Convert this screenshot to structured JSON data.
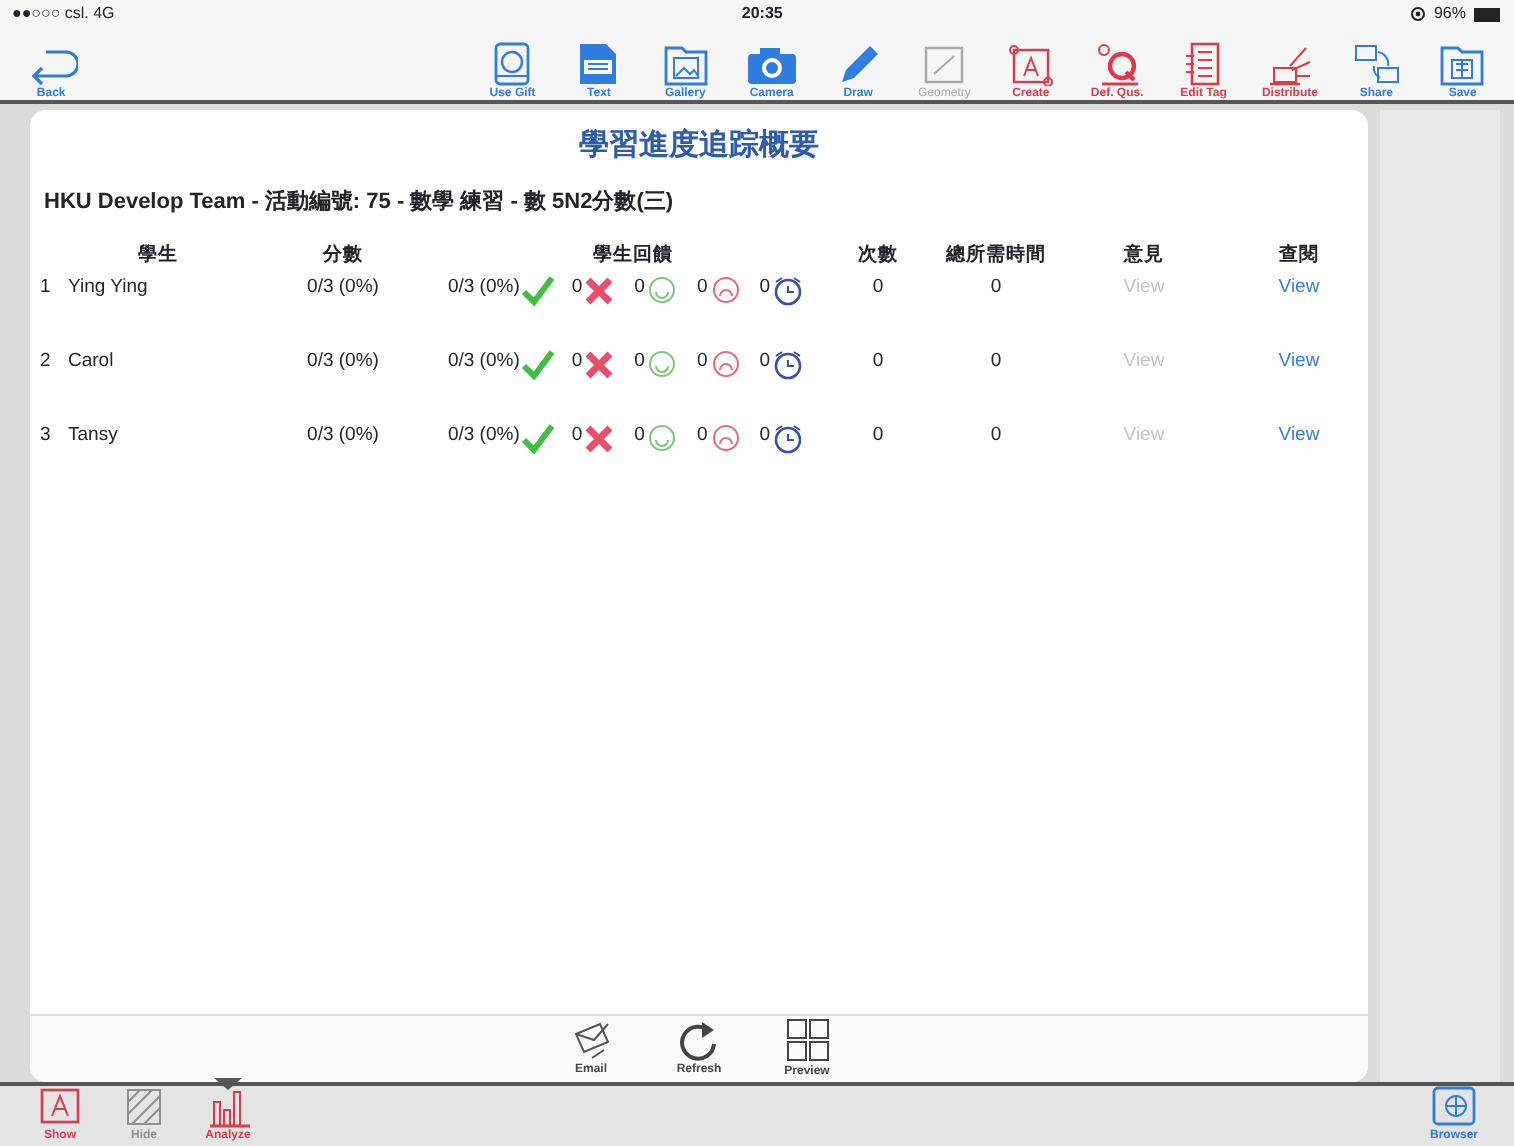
{
  "status_bar": {
    "carrier": "●●○○○ csl.  4G",
    "time": "20:35",
    "battery": "96%"
  },
  "toolbar": [
    {
      "label": "Back",
      "kind": "back",
      "color": "#2f7de1",
      "disabled": false
    },
    {
      "label": "Use Gift",
      "kind": "gift",
      "color": "#2f7de1",
      "disabled": false
    },
    {
      "label": "Text",
      "kind": "text",
      "color": "#2f7de1",
      "disabled": false
    },
    {
      "label": "Gallery",
      "kind": "gallery",
      "color": "#2f7de1",
      "disabled": false
    },
    {
      "label": "Camera",
      "kind": "camera",
      "color": "#2f7de1",
      "disabled": false
    },
    {
      "label": "Draw",
      "kind": "draw",
      "color": "#2f7de1",
      "disabled": false
    },
    {
      "label": "Geometry",
      "kind": "geometry",
      "color": "#a8a8a8",
      "disabled": true
    },
    {
      "label": "Create",
      "kind": "create",
      "color": "#e0394a",
      "disabled": false
    },
    {
      "label": "Def. Qus.",
      "kind": "defq",
      "color": "#e0394a",
      "disabled": false
    },
    {
      "label": "Edit Tag",
      "kind": "edittag",
      "color": "#e0394a",
      "disabled": false
    },
    {
      "label": "Distribute",
      "kind": "distribute",
      "color": "#e0394a",
      "disabled": false
    },
    {
      "label": "Share",
      "kind": "share",
      "color": "#2f7de1",
      "disabled": false
    },
    {
      "label": "Save",
      "kind": "save",
      "color": "#2f7de1",
      "disabled": false
    }
  ],
  "dialog": {
    "title": "學習進度追踪概要",
    "subtitle": "HKU Develop Team - 活動編號: 75 - 數學 練習 - 數 5N2分數(三)",
    "table": {
      "columns": [
        "學生",
        "分數",
        "學生回饋",
        "次數",
        "總所需時間",
        "意見",
        "查閱"
      ],
      "rows": [
        {
          "index": "1",
          "name": "Ying Ying",
          "score": "0/3 (0%)",
          "correct": "0/3 (0%)",
          "wrong": "0",
          "happy": "0",
          "sad": "0",
          "timeout": "0",
          "attempts": "0",
          "time": "0",
          "comment": {
            "label": "View",
            "disabled": true
          },
          "review": {
            "label": "View",
            "disabled": false
          }
        },
        {
          "index": "2",
          "name": "Carol",
          "score": "0/3 (0%)",
          "correct": "0/3 (0%)",
          "wrong": "0",
          "happy": "0",
          "sad": "0",
          "timeout": "0",
          "attempts": "0",
          "time": "0",
          "comment": {
            "label": "View",
            "disabled": true
          },
          "review": {
            "label": "View",
            "disabled": false
          }
        },
        {
          "index": "3",
          "name": "Tansy",
          "score": "0/3 (0%)",
          "correct": "0/3 (0%)",
          "wrong": "0",
          "happy": "0",
          "sad": "0",
          "timeout": "0",
          "attempts": "0",
          "time": "0",
          "comment": {
            "label": "View",
            "disabled": true
          },
          "review": {
            "label": "View",
            "disabled": false
          }
        }
      ]
    },
    "footer_buttons": [
      {
        "label": "Email",
        "kind": "email"
      },
      {
        "label": "Refresh",
        "kind": "refresh"
      },
      {
        "label": "Preview",
        "kind": "preview"
      }
    ]
  },
  "bottom_tabs": [
    {
      "label": "Show",
      "kind": "show",
      "selected": false,
      "disabled": false
    },
    {
      "label": "Hide",
      "kind": "hide",
      "selected": false,
      "disabled": true
    },
    {
      "label": "Analyze",
      "kind": "analyze",
      "selected": true,
      "disabled": false
    }
  ],
  "browser_button": {
    "label": "Browser"
  }
}
